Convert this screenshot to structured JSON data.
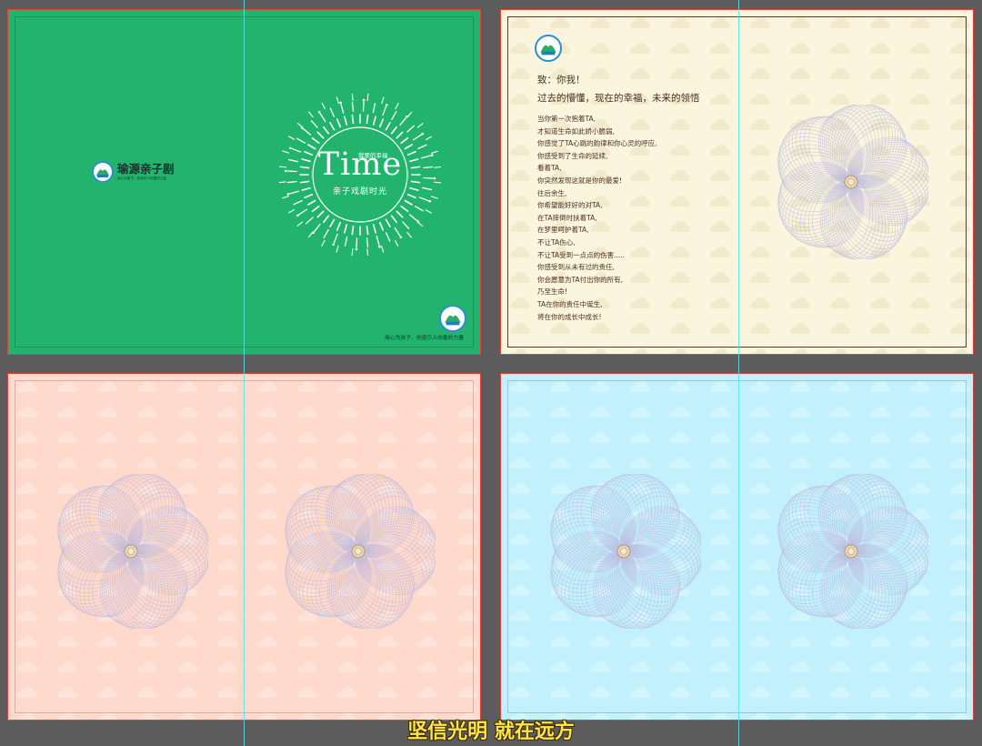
{
  "colors": {
    "background": "#5c5c5c",
    "cover": "#22b46d",
    "letter": "#faf5dc",
    "peach": "#ffd9cb",
    "sky": "#c2f1fd",
    "guide": "#4fe3ef",
    "border": "#e0413a"
  },
  "cover": {
    "brand_name": "瑜源亲子剧",
    "brand_sub": "用心为孩子，创造引人向善的力量",
    "logo_text": "瑜源",
    "sun_top": "我要的幸福",
    "sun_title": "Time",
    "sun_bottom": "亲子戏剧时光",
    "slogan": "用心为孩子，创造引人向善的力量"
  },
  "letter": {
    "logo_text": "瑜源",
    "greeting": "致：你我！",
    "headline": "过去的懵懂，现在的幸福，未来的领悟",
    "lines": [
      "当你第一次抱着TA,",
      "才知道生命如此娇小脆弱,",
      "你感觉了TA心跳的韵律和你心灵的呼应,",
      "你感受到了生命的延续,",
      "看着TA,",
      "你突然发现这就是你的最爱!",
      "往后余生,",
      "你希望能好好的对TA,",
      "在TA摔倒时扶着TA,",
      "在梦里呵护着TA,",
      "不让TA伤心,",
      "不让TA受到一点点的伤害.....",
      "你感受到从未有过的责任,",
      "你会愿意为TA付出你的所有,",
      "乃至生命!",
      "TA在你的责任中诞生,",
      "将在你的成长中成长!"
    ]
  },
  "icons": {
    "cover_logo": "brand-logo-icon",
    "sun": "sunburst-icon",
    "flower": "guilloche-flower-icon",
    "cloud": "cloud-pattern-icon"
  },
  "caption": "坚信光明 就在远方"
}
